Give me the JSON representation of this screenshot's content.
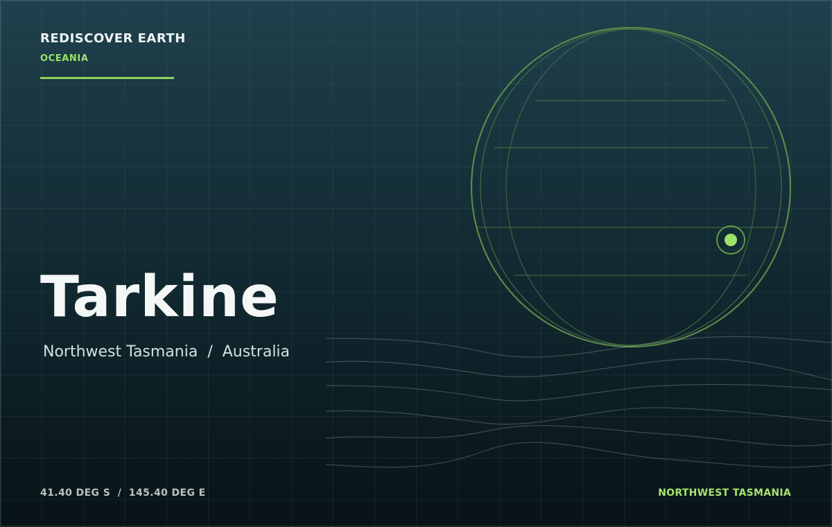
{
  "header": {
    "brand": "REDISCOVER EARTH",
    "region": "OCEANIA"
  },
  "place": {
    "name": "Tarkine",
    "subtitle": "Northwest Tasmania  /  Australia"
  },
  "footer": {
    "coordinates": "41.40 DEG S  /  145.40 DEG E",
    "locator": "NORTHWEST TASMANIA"
  },
  "colors": {
    "accent": "#9be36a",
    "globe_line": "#5a8a4a",
    "background_top": "#1f414d",
    "background_bottom": "#081316"
  },
  "icons": {
    "globe": "wireframe-globe-icon",
    "marker": "location-marker-icon"
  }
}
